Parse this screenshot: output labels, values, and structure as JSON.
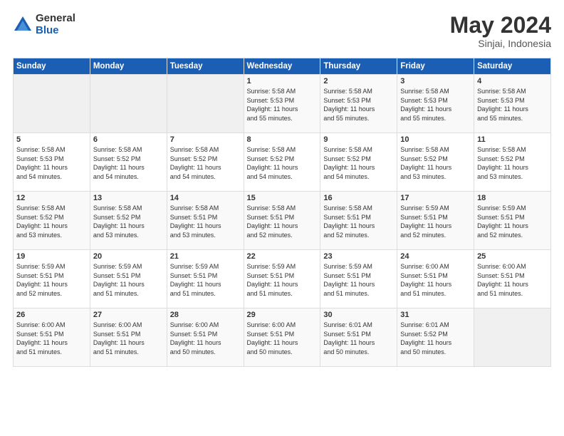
{
  "header": {
    "logo_general": "General",
    "logo_blue": "Blue",
    "month_title": "May 2024",
    "location": "Sinjai, Indonesia"
  },
  "days_of_week": [
    "Sunday",
    "Monday",
    "Tuesday",
    "Wednesday",
    "Thursday",
    "Friday",
    "Saturday"
  ],
  "weeks": [
    [
      {
        "day": "",
        "info": ""
      },
      {
        "day": "",
        "info": ""
      },
      {
        "day": "",
        "info": ""
      },
      {
        "day": "1",
        "info": "Sunrise: 5:58 AM\nSunset: 5:53 PM\nDaylight: 11 hours\nand 55 minutes."
      },
      {
        "day": "2",
        "info": "Sunrise: 5:58 AM\nSunset: 5:53 PM\nDaylight: 11 hours\nand 55 minutes."
      },
      {
        "day": "3",
        "info": "Sunrise: 5:58 AM\nSunset: 5:53 PM\nDaylight: 11 hours\nand 55 minutes."
      },
      {
        "day": "4",
        "info": "Sunrise: 5:58 AM\nSunset: 5:53 PM\nDaylight: 11 hours\nand 55 minutes."
      }
    ],
    [
      {
        "day": "5",
        "info": "Sunrise: 5:58 AM\nSunset: 5:53 PM\nDaylight: 11 hours\nand 54 minutes."
      },
      {
        "day": "6",
        "info": "Sunrise: 5:58 AM\nSunset: 5:52 PM\nDaylight: 11 hours\nand 54 minutes."
      },
      {
        "day": "7",
        "info": "Sunrise: 5:58 AM\nSunset: 5:52 PM\nDaylight: 11 hours\nand 54 minutes."
      },
      {
        "day": "8",
        "info": "Sunrise: 5:58 AM\nSunset: 5:52 PM\nDaylight: 11 hours\nand 54 minutes."
      },
      {
        "day": "9",
        "info": "Sunrise: 5:58 AM\nSunset: 5:52 PM\nDaylight: 11 hours\nand 54 minutes."
      },
      {
        "day": "10",
        "info": "Sunrise: 5:58 AM\nSunset: 5:52 PM\nDaylight: 11 hours\nand 53 minutes."
      },
      {
        "day": "11",
        "info": "Sunrise: 5:58 AM\nSunset: 5:52 PM\nDaylight: 11 hours\nand 53 minutes."
      }
    ],
    [
      {
        "day": "12",
        "info": "Sunrise: 5:58 AM\nSunset: 5:52 PM\nDaylight: 11 hours\nand 53 minutes."
      },
      {
        "day": "13",
        "info": "Sunrise: 5:58 AM\nSunset: 5:52 PM\nDaylight: 11 hours\nand 53 minutes."
      },
      {
        "day": "14",
        "info": "Sunrise: 5:58 AM\nSunset: 5:51 PM\nDaylight: 11 hours\nand 53 minutes."
      },
      {
        "day": "15",
        "info": "Sunrise: 5:58 AM\nSunset: 5:51 PM\nDaylight: 11 hours\nand 52 minutes."
      },
      {
        "day": "16",
        "info": "Sunrise: 5:58 AM\nSunset: 5:51 PM\nDaylight: 11 hours\nand 52 minutes."
      },
      {
        "day": "17",
        "info": "Sunrise: 5:59 AM\nSunset: 5:51 PM\nDaylight: 11 hours\nand 52 minutes."
      },
      {
        "day": "18",
        "info": "Sunrise: 5:59 AM\nSunset: 5:51 PM\nDaylight: 11 hours\nand 52 minutes."
      }
    ],
    [
      {
        "day": "19",
        "info": "Sunrise: 5:59 AM\nSunset: 5:51 PM\nDaylight: 11 hours\nand 52 minutes."
      },
      {
        "day": "20",
        "info": "Sunrise: 5:59 AM\nSunset: 5:51 PM\nDaylight: 11 hours\nand 51 minutes."
      },
      {
        "day": "21",
        "info": "Sunrise: 5:59 AM\nSunset: 5:51 PM\nDaylight: 11 hours\nand 51 minutes."
      },
      {
        "day": "22",
        "info": "Sunrise: 5:59 AM\nSunset: 5:51 PM\nDaylight: 11 hours\nand 51 minutes."
      },
      {
        "day": "23",
        "info": "Sunrise: 5:59 AM\nSunset: 5:51 PM\nDaylight: 11 hours\nand 51 minutes."
      },
      {
        "day": "24",
        "info": "Sunrise: 6:00 AM\nSunset: 5:51 PM\nDaylight: 11 hours\nand 51 minutes."
      },
      {
        "day": "25",
        "info": "Sunrise: 6:00 AM\nSunset: 5:51 PM\nDaylight: 11 hours\nand 51 minutes."
      }
    ],
    [
      {
        "day": "26",
        "info": "Sunrise: 6:00 AM\nSunset: 5:51 PM\nDaylight: 11 hours\nand 51 minutes."
      },
      {
        "day": "27",
        "info": "Sunrise: 6:00 AM\nSunset: 5:51 PM\nDaylight: 11 hours\nand 51 minutes."
      },
      {
        "day": "28",
        "info": "Sunrise: 6:00 AM\nSunset: 5:51 PM\nDaylight: 11 hours\nand 50 minutes."
      },
      {
        "day": "29",
        "info": "Sunrise: 6:00 AM\nSunset: 5:51 PM\nDaylight: 11 hours\nand 50 minutes."
      },
      {
        "day": "30",
        "info": "Sunrise: 6:01 AM\nSunset: 5:51 PM\nDaylight: 11 hours\nand 50 minutes."
      },
      {
        "day": "31",
        "info": "Sunrise: 6:01 AM\nSunset: 5:52 PM\nDaylight: 11 hours\nand 50 minutes."
      },
      {
        "day": "",
        "info": ""
      }
    ]
  ]
}
